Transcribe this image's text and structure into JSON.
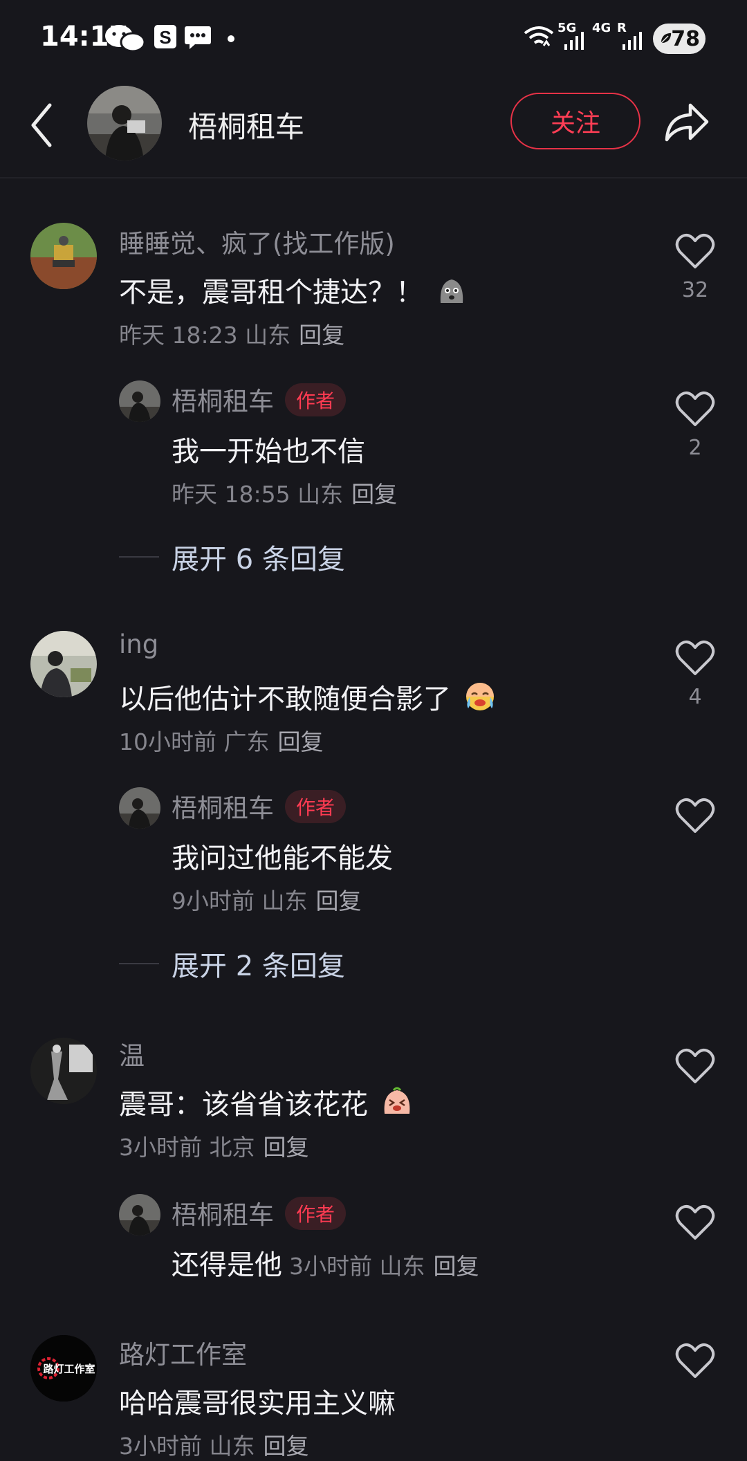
{
  "status": {
    "time": "14:17",
    "network1": "5G",
    "network2": "4G",
    "network3": "R",
    "battery": "78"
  },
  "header": {
    "title": "梧桐租车",
    "follow_label": "关注"
  },
  "comments": [
    {
      "user": "睡睡觉、疯了(找工作版)",
      "text": "不是，震哥租个捷达？！",
      "meta": "昨天 18:23 山东",
      "reply": "回复",
      "likes": "32"
    },
    {
      "user": "梧桐租车",
      "badge": "作者",
      "text": "我一开始也不信",
      "meta": "昨天 18:55 山东",
      "reply": "回复",
      "likes": "2"
    },
    {
      "expand": "展开 6 条回复"
    },
    {
      "user": "ing",
      "text": "以后他估计不敢随便合影了",
      "meta": "10小时前 广东",
      "reply": "回复",
      "likes": "4"
    },
    {
      "user": "梧桐租车",
      "badge": "作者",
      "text": "我问过他能不能发",
      "meta": "9小时前 山东",
      "reply": "回复",
      "likes": ""
    },
    {
      "expand": "展开 2 条回复"
    },
    {
      "user": "温",
      "text": "震哥：该省省该花花",
      "meta": "3小时前 北京",
      "reply": "回复",
      "likes": ""
    },
    {
      "user": "梧桐租车",
      "badge": "作者",
      "text": "还得是他",
      "meta": "3小时前 山东",
      "reply": "回复",
      "likes": ""
    },
    {
      "user": "路灯工作室",
      "text": "哈哈震哥很实用主义嘛",
      "meta": "3小时前 山东",
      "reply": "回复",
      "likes": ""
    }
  ],
  "logo_text": "路灯工作室"
}
